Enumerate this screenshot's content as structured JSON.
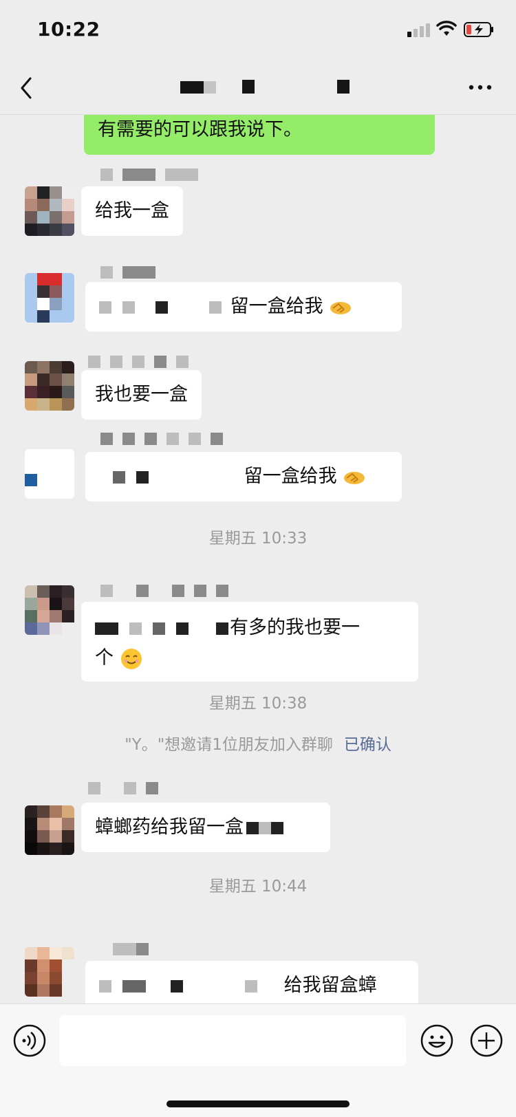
{
  "status_bar": {
    "time": "10:22",
    "battery_color": "#e0493f"
  },
  "nav": {
    "icons": [
      "back-icon",
      "more-icon"
    ]
  },
  "messages": {
    "m0": "有需要的可以跟我说下。",
    "m1": "给我一盒",
    "m2": "留一盒给我",
    "m3": "我也要一盒",
    "m4": "留一盒给我",
    "m5_line1": "有多的我也要一",
    "m5_line2": "个",
    "m6": "蟑螂药给我留一盒",
    "m7": "给我留盒蟑"
  },
  "timestamps": {
    "t1": "星期五 10:33",
    "t2": "星期五 10:38",
    "t3": "星期五 10:44"
  },
  "system": {
    "invite_text": "\"Y。\"想邀请1位朋友加入群聊",
    "invite_link": "已确认"
  },
  "input": {
    "placeholder": ""
  },
  "colors": {
    "bubble_self": "#95ec69",
    "bubble_other": "#ffffff",
    "background": "#ededed",
    "link": "#576b95"
  }
}
